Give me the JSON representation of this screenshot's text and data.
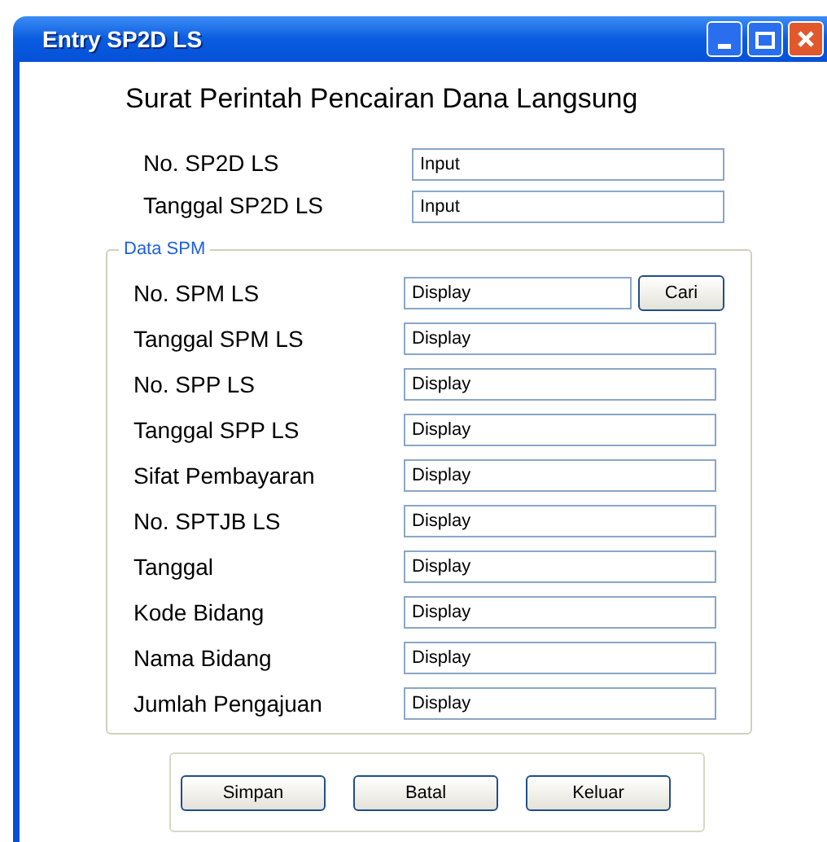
{
  "window": {
    "title": "Entry SP2D LS"
  },
  "heading": "Surat Perintah Pencairan Dana Langsung",
  "top_fields": [
    {
      "label": "No. SP2D LS",
      "value": "Input"
    },
    {
      "label": "Tanggal SP2D LS",
      "value": "Input"
    }
  ],
  "group": {
    "title": "Data SPM",
    "fields": [
      {
        "label": "No. SPM LS",
        "value": "Display",
        "button": "Cari"
      },
      {
        "label": "Tanggal SPM LS",
        "value": "Display"
      },
      {
        "label": "No. SPP LS",
        "value": "Display"
      },
      {
        "label": "Tanggal SPP LS",
        "value": "Display"
      },
      {
        "label": "Sifat Pembayaran",
        "value": "Display"
      },
      {
        "label": "No. SPTJB LS",
        "value": "Display"
      },
      {
        "label": "Tanggal",
        "value": "Display"
      },
      {
        "label": "Kode Bidang",
        "value": "Display"
      },
      {
        "label": "Nama Bidang",
        "value": "Display"
      },
      {
        "label": "Jumlah Pengajuan",
        "value": "Display"
      }
    ]
  },
  "buttons": [
    "Simpan",
    "Batal",
    "Keluar"
  ]
}
